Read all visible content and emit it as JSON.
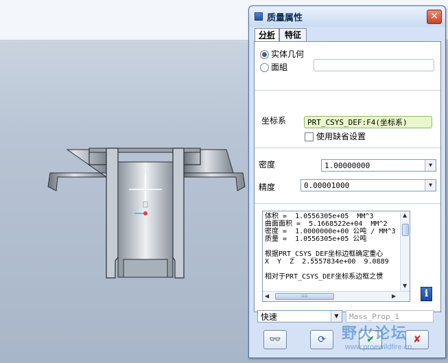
{
  "dialog": {
    "title": "质量属性",
    "close_glyph": "✕"
  },
  "tabs": [
    {
      "label": "分析",
      "active": true
    },
    {
      "label": "特征",
      "active": false
    }
  ],
  "geometry_type": {
    "options": [
      "实体几何",
      "面組"
    ],
    "selected": "实体几何",
    "surface_value": ""
  },
  "coordinate_system": {
    "label": "坐标系",
    "value": "PRT_CSYS_DEF:F4(坐标系)",
    "use_default_label": "使用缺省设置",
    "use_default_checked": false
  },
  "density": {
    "label": "密度",
    "value": "1.00000000"
  },
  "precision": {
    "label": "精度",
    "value": "0.00001000"
  },
  "results": {
    "lines": [
      "体积 =  1.0556305e+05  MM^3",
      "曲面面积 =  5.1668522e+04  MM^2",
      "密度 =  1.0000000e+00 公吨 / MM^3",
      "质量 =  1.0556305e+05 公吨",
      "",
      "根据PRT_CSYS_DEF坐标边框确定重心",
      "X  Y  Z  2.5557834e+00  9.0889",
      "",
      "相对于PRT_CSYS_DEF坐标系边框之惯"
    ],
    "hthumb_glyph": "::::"
  },
  "quick_mode": {
    "value": "快速"
  },
  "feature_name": {
    "placeholder": "Mass_Prop_1"
  },
  "buttons": {
    "glasses": "👓",
    "repeat": "⟳",
    "ok": "✔",
    "cancel": "✘",
    "info": "i"
  },
  "watermark": {
    "title": "野火论坛",
    "url": "www.proewildfire.cn"
  },
  "colors": {
    "coord_field_bg": "#e8f7cc",
    "model_fill": "#b4bcc6",
    "model_dark": "#3a3f46",
    "viewport_bg": "#b8c4d4"
  }
}
